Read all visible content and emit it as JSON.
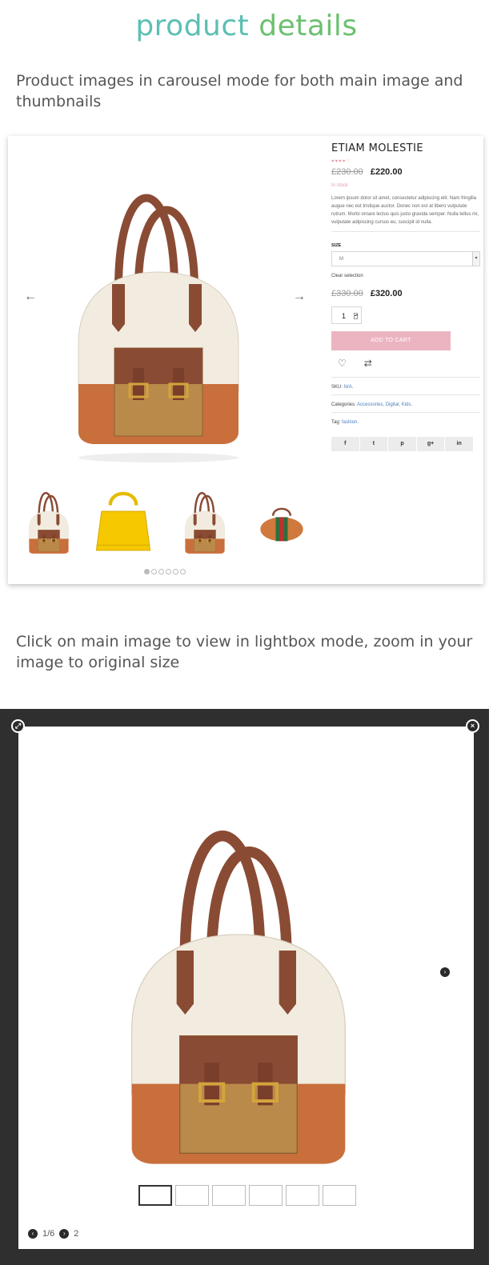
{
  "hero": {
    "word1": "product",
    "word2": "details"
  },
  "captions": {
    "carousel": "Product images in carousel mode for both main image and thumbnails",
    "lightbox": "Click on main image to view in lightbox mode, zoom in your image to original size"
  },
  "product": {
    "title": "ETIAM MOLESTIE",
    "rating_stars": "♥♥♥♥♡",
    "old_price": "£230.00",
    "price": "£220.00",
    "stock": "In stock",
    "description": "Lorem ipsum dolor sit amet, consectetur adipiscing elit. Nam fringilla augue nec est tristique auctor. Donec non est at libero vulputate rutrum. Morbi ornare lectus quis justo gravida semper. Nulla tellus mi, vulputate adipiscing cursus eu, suscipit id nulla.",
    "size_label": "SIZE",
    "size_value": "M",
    "clear_selection": "Clear selection",
    "variant_old_price": "£330.00",
    "variant_price": "£320.00",
    "quantity": "1",
    "add_to_cart": "ADD TO CART",
    "sku_label": "SKU:",
    "sku_value": "N/A.",
    "categories_label": "Categories:",
    "categories_value": "Accessories, Digital, Kids.",
    "tag_label": "Tag:",
    "tag_value": "fashion.",
    "share_icons": [
      "f",
      "t",
      "p",
      "g+",
      "in"
    ]
  },
  "carousel": {
    "prev_icon": "←",
    "next_icon": "→",
    "dot_count": 6,
    "active_dot": 0
  },
  "lightbox": {
    "counter": "1/6",
    "next_count": "2",
    "expand_icon": "⤢",
    "close_icon": "×",
    "next_icon": "›"
  },
  "colors": {
    "teal": "#5cbfb3",
    "green": "#6cc070",
    "pink": "#ecb4c1",
    "link": "#4a7fc0"
  }
}
